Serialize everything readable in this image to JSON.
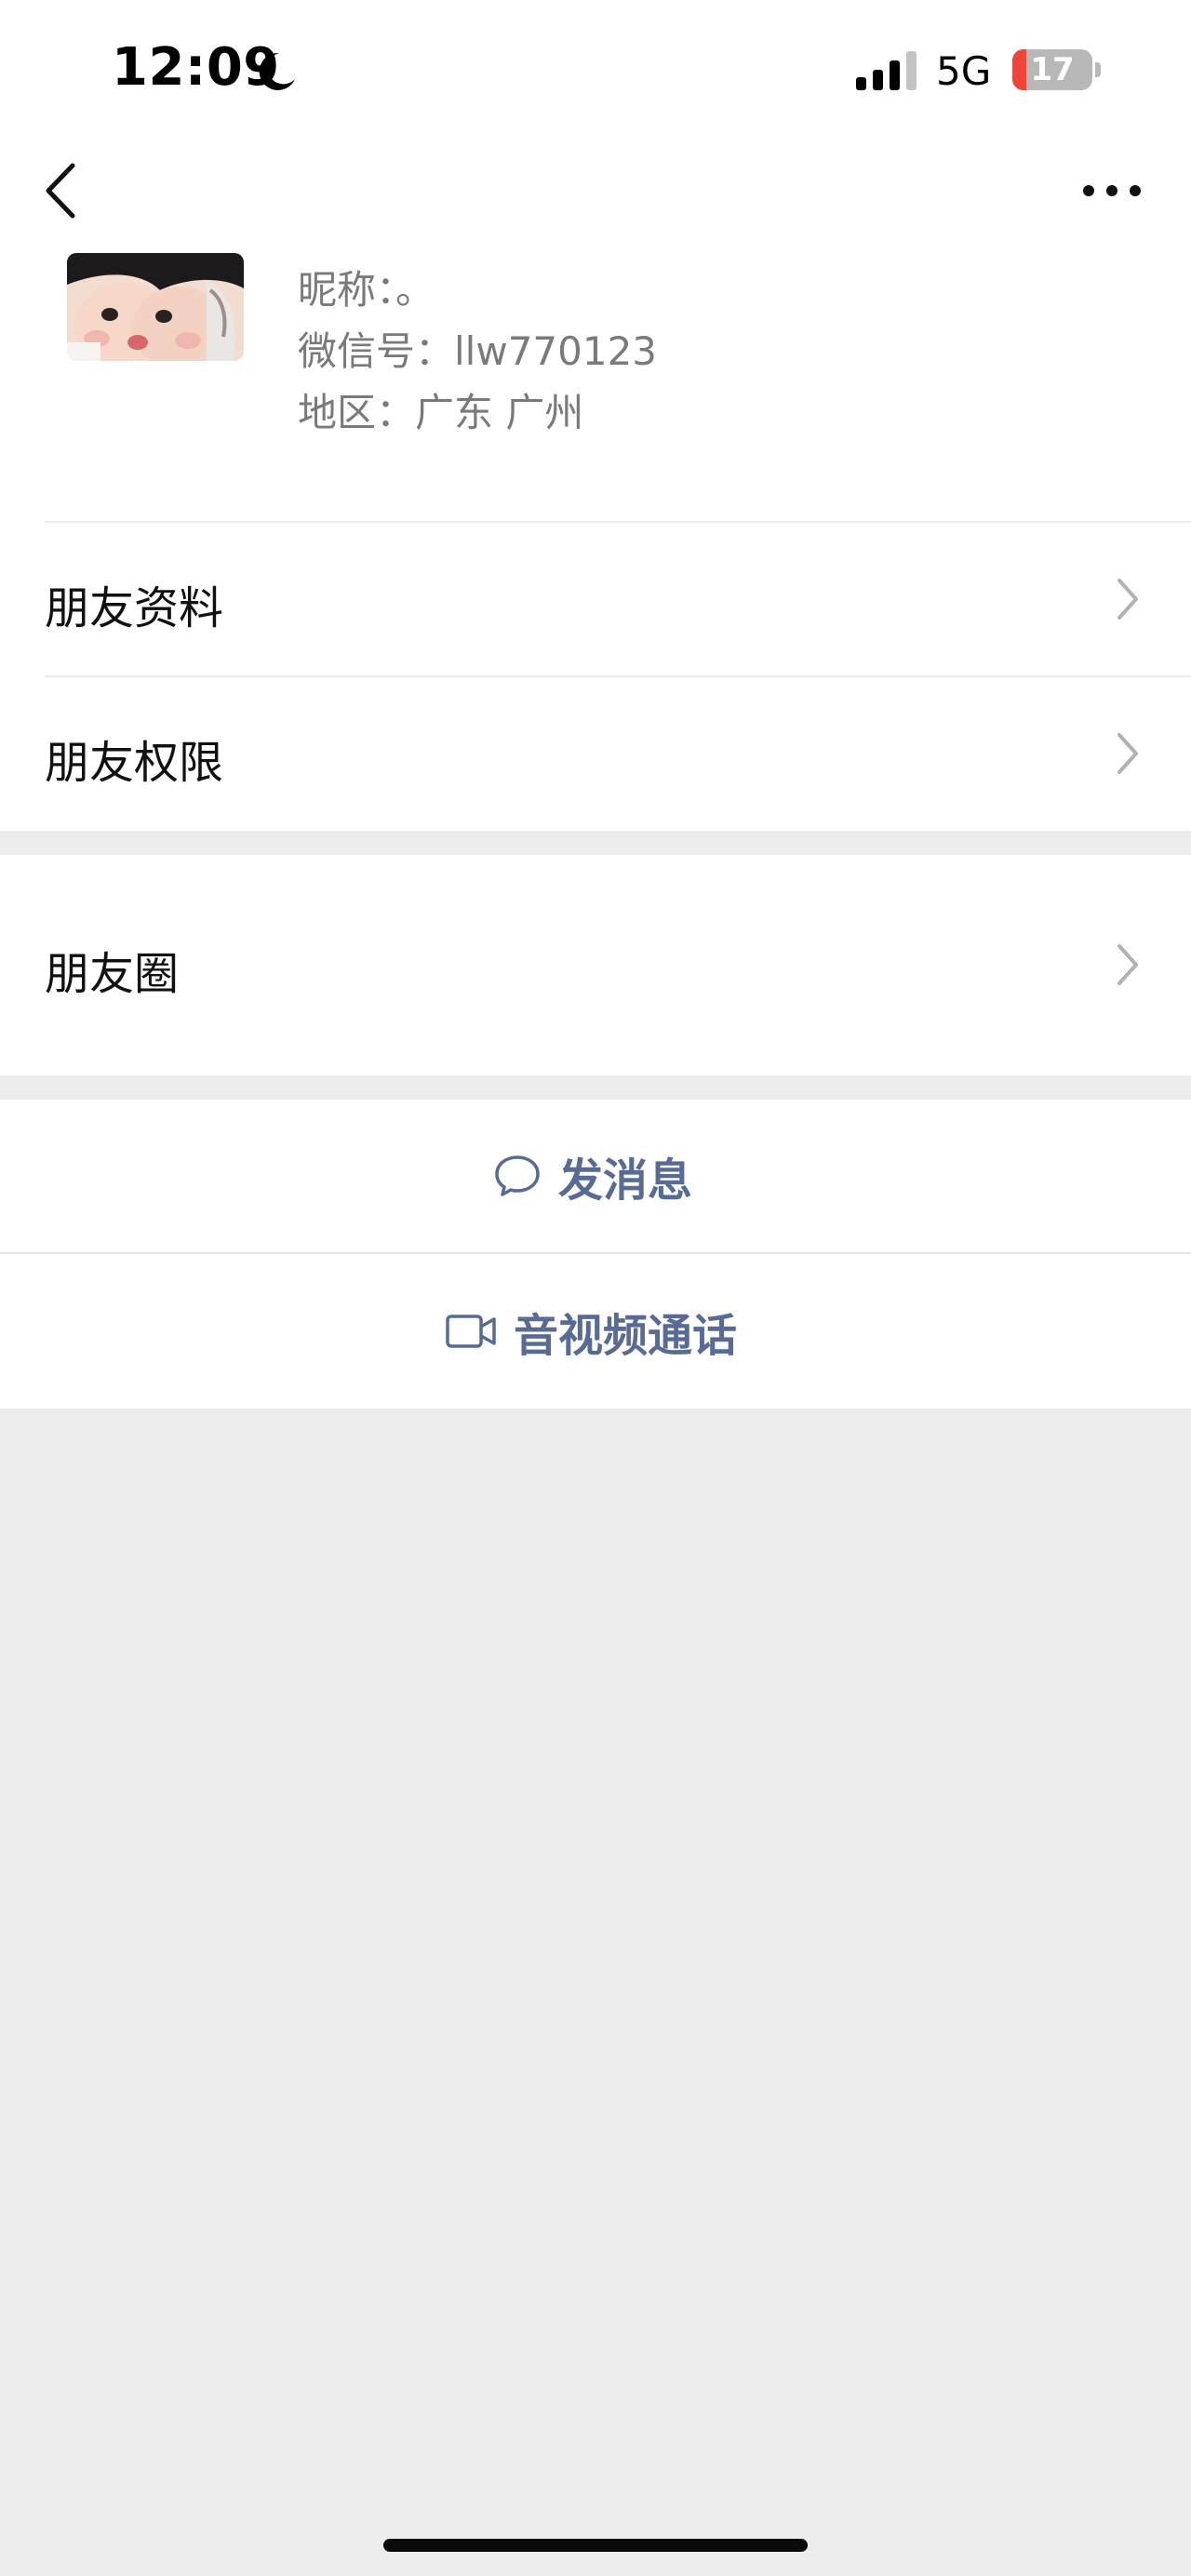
{
  "status_bar": {
    "time": "12:09",
    "network": "5G",
    "battery_level": "17",
    "battery_fraction": 0.17,
    "icons": [
      "moon-icon",
      "signal-icon",
      "battery-icon"
    ]
  },
  "nav": {
    "back_icon": "back-icon",
    "more_icon": "more-icon"
  },
  "profile": {
    "nickname_line": "昵称：。",
    "wechat_id_line": "微信号：llw770123",
    "region_line": "地区：广东 广州"
  },
  "menu": {
    "friend_info": "朋友资料",
    "friend_permissions": "朋友权限",
    "moments": "朋友圈"
  },
  "actions": {
    "send_message": "发消息",
    "video_call": "音视频通话"
  },
  "colors": {
    "link_blue": "#576b95",
    "page_background": "#ededed",
    "battery_low": "#f04438"
  }
}
